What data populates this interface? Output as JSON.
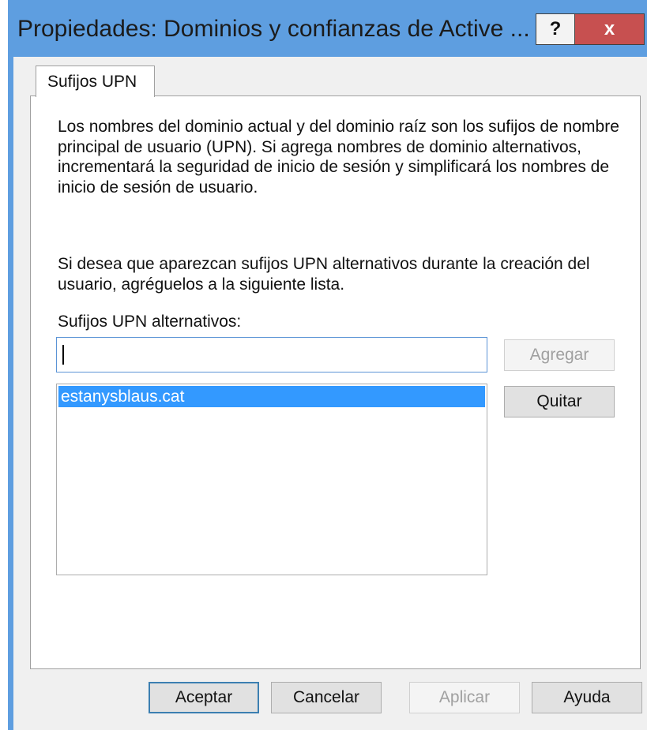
{
  "window": {
    "title": "Propiedades: Dominios y confianzas de Active ...",
    "help_label": "?",
    "close_label": "x"
  },
  "tabs": [
    {
      "label": "Sufijos UPN",
      "selected": true
    }
  ],
  "content": {
    "description_1": "Los nombres del dominio actual y del dominio raíz son los sufijos de nombre principal de usuario (UPN). Si agrega nombres de dominio alternativos, incrementará la seguridad de inicio de sesión y simplificará los nombres de inicio de sesión de usuario.",
    "description_2": "Si desea que aparezcan sufijos UPN alternativos durante la creación del usuario, agréguelos a la siguiente lista.",
    "list_label": "Sufijos UPN alternativos:",
    "input_value": "",
    "add_button": "Agregar",
    "remove_button": "Quitar",
    "suffixes": [
      "estanysblaus.cat"
    ]
  },
  "footer": {
    "ok": "Aceptar",
    "cancel": "Cancelar",
    "apply": "Aplicar",
    "help": "Ayuda"
  },
  "colors": {
    "titlebar": "#5e9ee0",
    "close_button": "#c75050",
    "selection": "#3399ff",
    "default_button_border": "#3c7fb1"
  }
}
